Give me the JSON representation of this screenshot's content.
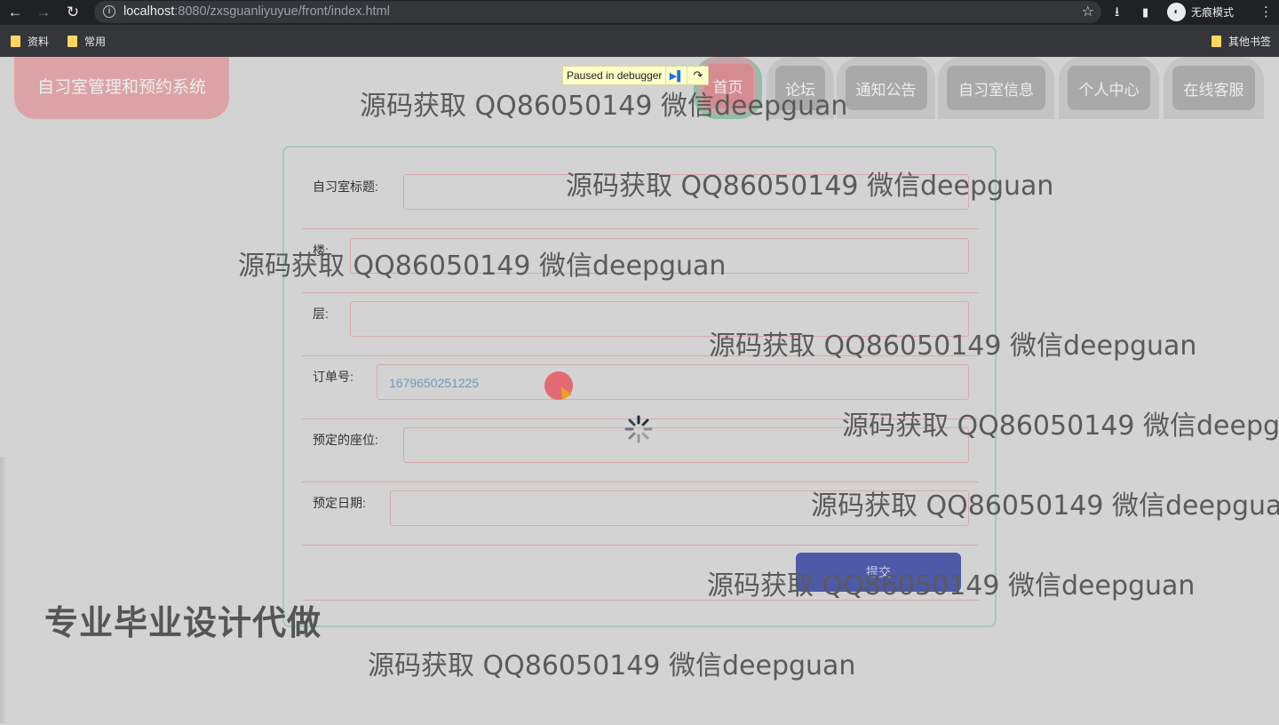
{
  "browser": {
    "url_host": "localhost",
    "url_rest": ":8080/zxsguanliyuyue/front/index.html",
    "incognito_label": "无痕模式",
    "bookmarks": [
      "资料",
      "常用"
    ],
    "other_bookmarks": "其他书签"
  },
  "debugger": {
    "label": "Paused in debugger"
  },
  "site": {
    "logo": "自习室管理和预约系统",
    "nav": [
      {
        "label": "首页",
        "active": true
      },
      {
        "label": "论坛"
      },
      {
        "label": "通知公告"
      },
      {
        "label": "自习室信息"
      },
      {
        "label": "个人中心"
      },
      {
        "label": "在线客服"
      }
    ]
  },
  "form": {
    "fields": [
      {
        "label": "自习室标题:",
        "value": ""
      },
      {
        "label": "楼:",
        "value": ""
      },
      {
        "label": "层:",
        "value": ""
      },
      {
        "label": "订单号:",
        "value": "1679650251225"
      },
      {
        "label": "预定的座位:",
        "value": ""
      },
      {
        "label": "预定日期:",
        "value": ""
      }
    ],
    "submit_label": "提交"
  },
  "promo": "专业毕业设计代做",
  "watermark": "源码获取 QQ86050149 微信deepguan",
  "colors": {
    "accent_pink": "#dca3a6",
    "active_nav_border": "#8fbfa6",
    "submit_blue": "#4e59a8",
    "order_number": "#6a9ab8"
  }
}
